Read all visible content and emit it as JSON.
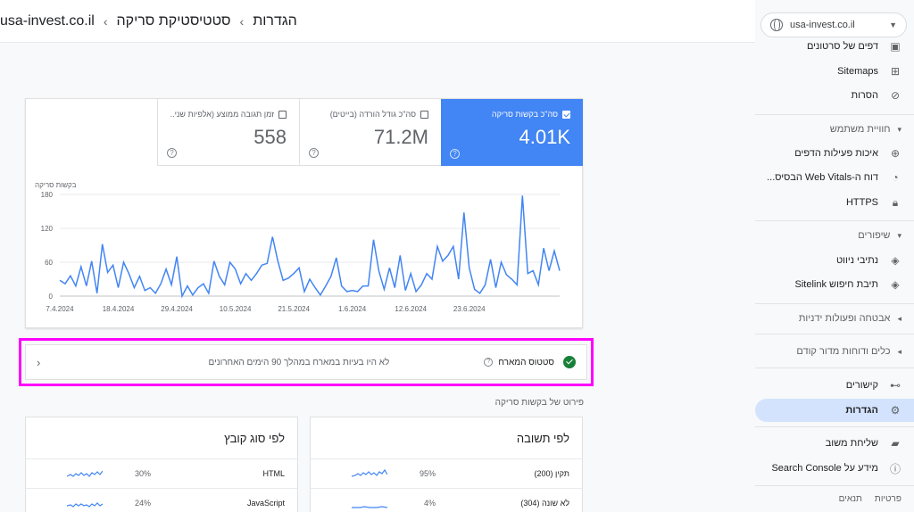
{
  "header": {
    "crumb_settings": "הגדרות",
    "crumb_stats": "סטטיסטיקת סריקה",
    "crumb_site": "usa-invest.co.il"
  },
  "sidebar": {
    "property": "usa-invest.co.il",
    "items_top": [
      {
        "label": "דפים של סרטונים",
        "icon": "video-page-icon"
      },
      {
        "label": "Sitemaps",
        "icon": "sitemap-icon"
      },
      {
        "label": "הסרות",
        "icon": "eye-off-icon"
      }
    ],
    "section_experience": "חוויית משתמש",
    "items_experience": [
      {
        "label": "איכות פעילות הדפים",
        "icon": "plus-circle-icon"
      },
      {
        "label": "דוח ה-Web Vitals הבסיס...",
        "icon": "gauge-icon"
      },
      {
        "label": "HTTPS",
        "icon": "lock-icon"
      }
    ],
    "section_enhancements": "שיפורים",
    "items_enhancements": [
      {
        "label": "נתיבי ניווט",
        "icon": "layers-icon"
      },
      {
        "label": "תיבת חיפוש Sitelink",
        "icon": "layers-icon"
      }
    ],
    "section_security": "אבטחה ופעולות ידניות",
    "section_legacy": "כלים ודוחות מדור קודם",
    "items_bottom": [
      {
        "label": "קישורים",
        "icon": "network-icon"
      },
      {
        "label": "הגדרות",
        "icon": "gear-icon"
      }
    ],
    "items_footer": [
      {
        "label": "שליחת משוב",
        "icon": "feedback-icon"
      },
      {
        "label": "מידע על Search Console",
        "icon": "info-icon"
      }
    ],
    "footer_privacy": "פרטיות",
    "footer_terms": "תנאים"
  },
  "metrics": {
    "requests_label": "סה\"כ בקשות סריקה",
    "requests_value": "4.01K",
    "download_label": "סה\"כ גודל הורדה (בייטים)",
    "download_value": "71.2M",
    "response_label": "זמן תגובה ממוצע (אלפיות שני...",
    "response_value": "558",
    "help_glyph": "?"
  },
  "chart_data": {
    "type": "line",
    "ylabel": "בקשות סריקה",
    "ylim": [
      0,
      180
    ],
    "yticks": [
      0,
      60,
      120,
      180
    ],
    "xtick_labels": [
      "7.4.2024",
      "18.4.2024",
      "29.4.2024",
      "10.5.2024",
      "21.5.2024",
      "1.6.2024",
      "12.6.2024",
      "23.6.2024"
    ],
    "xtick_index": [
      0,
      11,
      22,
      33,
      44,
      55,
      66,
      77
    ],
    "color": "#4285f4",
    "series": [
      {
        "values": [
          28,
          22,
          36,
          18,
          52,
          18,
          62,
          5,
          92,
          42,
          55,
          15,
          60,
          40,
          15,
          35,
          10,
          15,
          5,
          22,
          48,
          20,
          70,
          0,
          18,
          2,
          15,
          22,
          5,
          62,
          35,
          20,
          60,
          48,
          22,
          40,
          28,
          40,
          55,
          58,
          105,
          62,
          28,
          32,
          40,
          50,
          8,
          30,
          15,
          2,
          18,
          35,
          68,
          18,
          8,
          10,
          8,
          18,
          18,
          100,
          45,
          12,
          50,
          15,
          72,
          10,
          40,
          8,
          20,
          40,
          30,
          88,
          62,
          72,
          88,
          30,
          148,
          50,
          12,
          5,
          20,
          65,
          15,
          60,
          38,
          30,
          20,
          178,
          40,
          45,
          20,
          85,
          45,
          80,
          45
        ]
      }
    ]
  },
  "status": {
    "title": "סטטוס המארח",
    "message": "לא היו בעיות במארח במהלך 90 הימים האחרונים",
    "chevron": "‹"
  },
  "breakdown": {
    "title": "פירוט של בקשות סריקה",
    "by_response": {
      "title": "לפי תשובה",
      "rows": [
        {
          "label": "תקין (200)",
          "pct": "95%"
        },
        {
          "label": "לא שונה (304)",
          "pct": "4%"
        }
      ]
    },
    "by_filetype": {
      "title": "לפי סוג קובץ",
      "rows": [
        {
          "label": "HTML",
          "pct": "30%"
        },
        {
          "label": "JavaScript",
          "pct": "24%"
        }
      ]
    }
  }
}
